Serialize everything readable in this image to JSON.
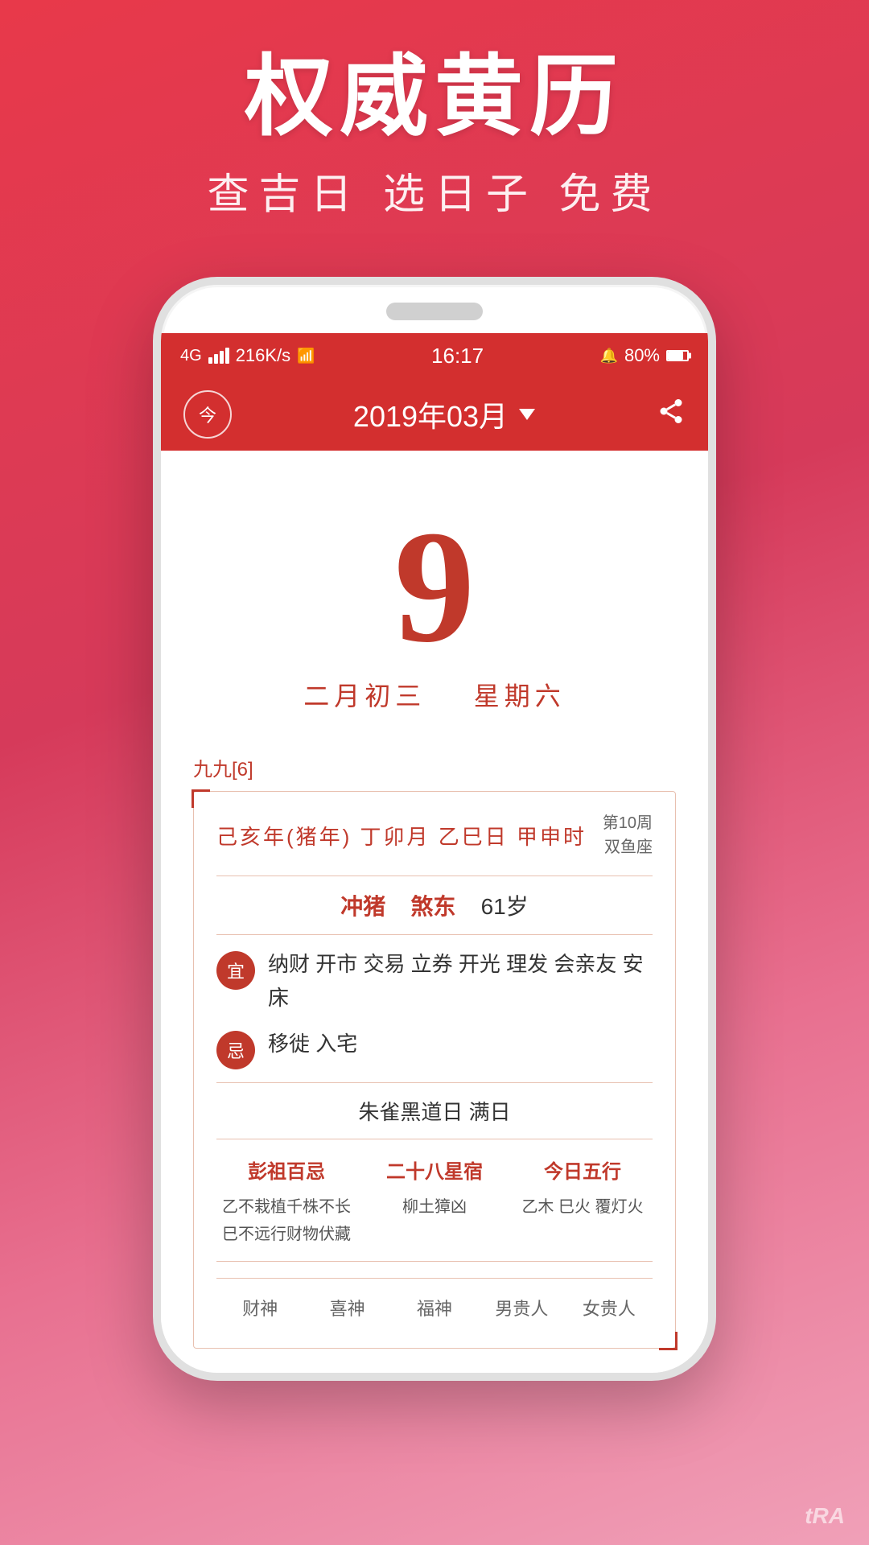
{
  "promo": {
    "title": "权威黄历",
    "subtitle": "查吉日 选日子 免费"
  },
  "status_bar": {
    "signal": "4G",
    "speed": "216K/s",
    "wifi": "WiFi",
    "time": "16:17",
    "alarm": "🔔",
    "battery": "80%"
  },
  "header": {
    "today_label": "今",
    "month_label": "2019年03月",
    "dropdown_hint": "▼"
  },
  "calendar": {
    "day": "9",
    "lunar_date": "二月初三",
    "weekday": "星期六",
    "nine_nine": "九九[6]",
    "ganzhi": "己亥年(猪年) 丁卯月 乙巳日 甲申时",
    "week_num": "第10周",
    "zodiac": "双鱼座",
    "chong": "冲猪",
    "sha": "煞东",
    "age": "61岁",
    "yi_label": "宜",
    "yi_content": "纳财 开市 交易 立券 开光 理发 会亲友 安床",
    "ji_label": "忌",
    "ji_content": "移徙 入宅",
    "black_day": "朱雀黑道日  满日",
    "section1": {
      "title": "彭祖百忌",
      "line1": "乙不栽植千株不长",
      "line2": "巳不远行财物伏藏"
    },
    "section2": {
      "title": "二十八星宿",
      "content": "柳土獐凶"
    },
    "section3": {
      "title": "今日五行",
      "content": "乙木 巳火 覆灯火"
    },
    "gods": {
      "caishen": "财神",
      "xishen": "喜神",
      "fushen": "福神",
      "nan_guiren": "男贵人",
      "nv_guiren": "女贵人"
    }
  },
  "watermark": "tRA"
}
